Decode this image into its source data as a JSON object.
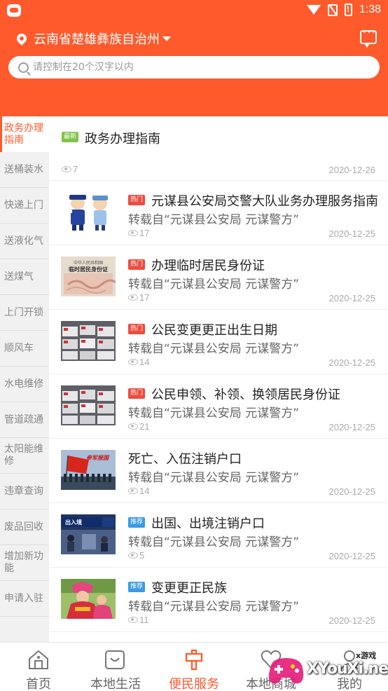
{
  "status_bar": {
    "time": "1:38"
  },
  "header": {
    "location": "云南省楚雄彝族自治州",
    "search_placeholder": "请控制在20个汉字以内"
  },
  "sidebar": {
    "items": [
      {
        "label": "政务办理指南",
        "active": true
      },
      {
        "label": "送桶装水"
      },
      {
        "label": "快递上门"
      },
      {
        "label": "送液化气"
      },
      {
        "label": "送煤气"
      },
      {
        "label": "上门开锁"
      },
      {
        "label": "顺风车"
      },
      {
        "label": "水电维修"
      },
      {
        "label": "管道疏通"
      },
      {
        "label": "太阳能维修"
      },
      {
        "label": "违章查询"
      },
      {
        "label": "废品回收"
      },
      {
        "label": "增加新功能"
      },
      {
        "label": "申请入驻"
      }
    ]
  },
  "first_item": {
    "badge": "最新",
    "title": "政务办理指南",
    "views": "7",
    "date": "2020-12-26"
  },
  "items": [
    {
      "badge": "热门",
      "title": "元谋县公安局交警大队业务办理服务指南",
      "source": "转载自“元谋县公安局  元谋警方”",
      "views": "17",
      "date": "2020-12-25"
    },
    {
      "badge": "热门",
      "title": "办理临时居民身份证",
      "source": "转载自“元谋县公安局  元谋警方”",
      "views": "17",
      "date": "2020-12-25"
    },
    {
      "badge": "热门",
      "title": "公民变更更正出生日期",
      "source": "转载自“元谋县公安局  元谋警方”",
      "views": "14",
      "date": "2020-12-25"
    },
    {
      "badge": "热门",
      "title": "公民申领、补领、换领居民身份证",
      "source": "转载自“元谋县公安局  元谋警方”",
      "views": "21",
      "date": "2020-12-25"
    },
    {
      "badge": "",
      "title": "死亡、入伍注销户口",
      "source": "转载自“元谋县公安局  元谋警方”",
      "views": "14",
      "date": "2020-12-25"
    },
    {
      "badge": "推荐",
      "title": "出国、出境注销户口",
      "source": "转载自“元谋县公安局  元谋警方”",
      "views": "5",
      "date": "2020-12-25"
    },
    {
      "badge": "推荐",
      "title": "变更更正民族",
      "source": "转载自“元谋县公安局  元谋警方”",
      "views": "11",
      "date": "2020-12-25"
    }
  ],
  "thumb_text": {
    "id_card_title": "中华人民共和国",
    "id_card_sub": "临时居民身份证",
    "flag_text": "参军报国",
    "exit_sign": "出入境"
  },
  "bottom_nav": {
    "items": [
      {
        "label": "首页"
      },
      {
        "label": "本地生活"
      },
      {
        "label": "便民服务",
        "active": true
      },
      {
        "label": "本地商城"
      },
      {
        "label": "我的"
      }
    ]
  },
  "watermark": {
    "text": "XYouXi.net",
    "small": "x游戏"
  },
  "colors": {
    "brand": "#ff5a2c",
    "new_badge": "#7dc448",
    "hot_badge": "#ec4c41",
    "rec_badge": "#3a9be6"
  }
}
